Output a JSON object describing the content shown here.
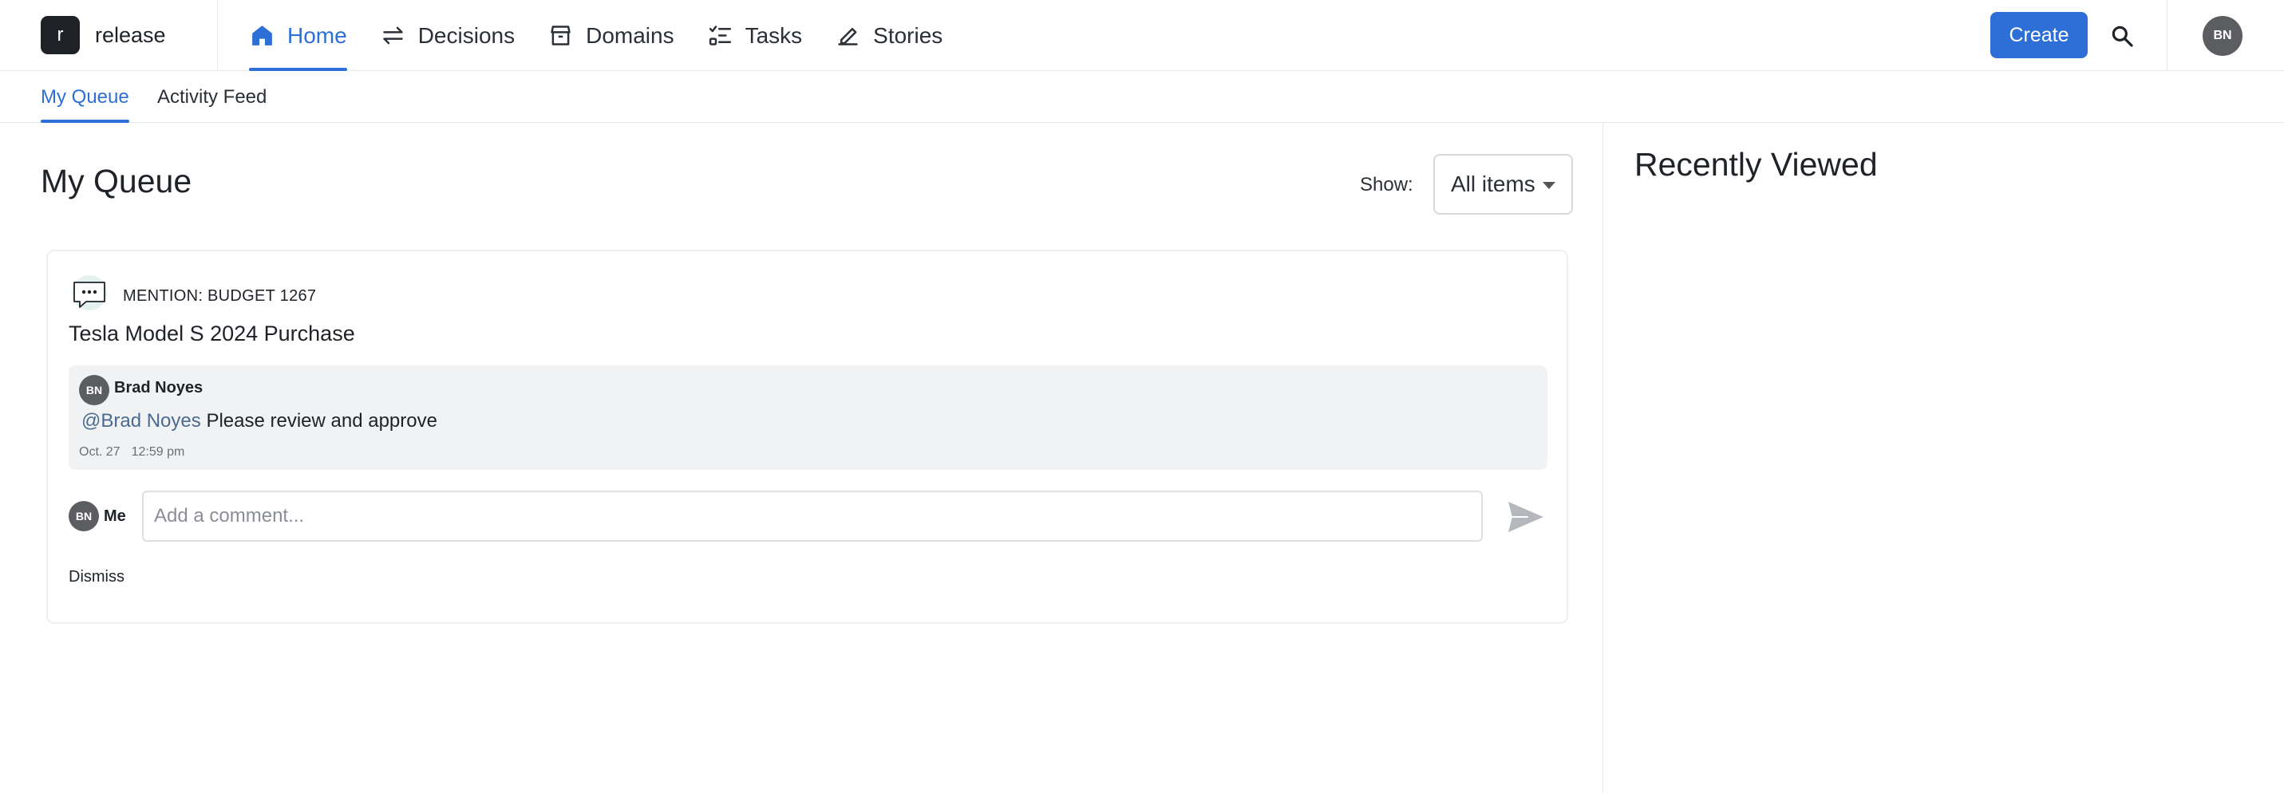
{
  "brand": {
    "logo_letter": "r",
    "name": "release"
  },
  "nav": {
    "items": [
      {
        "label": "Home",
        "icon": "home-icon",
        "active": true
      },
      {
        "label": "Decisions",
        "icon": "arrows-exchange-icon",
        "active": false
      },
      {
        "label": "Domains",
        "icon": "box-icon",
        "active": false
      },
      {
        "label": "Tasks",
        "icon": "checklist-icon",
        "active": false
      },
      {
        "label": "Stories",
        "icon": "pen-icon",
        "active": false
      }
    ],
    "create_label": "Create",
    "search_icon": "search-icon",
    "user_initials": "BN"
  },
  "subtabs": [
    {
      "label": "My Queue",
      "active": true
    },
    {
      "label": "Activity Feed",
      "active": false
    }
  ],
  "main": {
    "title": "My Queue",
    "show_label": "Show:",
    "show_value": "All items"
  },
  "queue_item": {
    "icon": "chat-bubble-icon",
    "kicker": "MENTION: BUDGET 1267",
    "title": "Tesla Model S 2024 Purchase",
    "comment": {
      "author_initials": "BN",
      "author": "Brad Noyes",
      "mention": "@Brad Noyes",
      "text": "Please review and approve",
      "date": "Oct. 27",
      "time": "12:59 pm"
    },
    "reply": {
      "initials": "BN",
      "label": "Me",
      "placeholder": "Add a comment..."
    },
    "dismiss_label": "Dismiss"
  },
  "recently_viewed": {
    "title": "Recently Viewed"
  },
  "colors": {
    "accent": "#2d6fd6",
    "avatar": "#5b5d60",
    "mention": "#4b6a90",
    "comment_bg": "#f1f2f4"
  }
}
